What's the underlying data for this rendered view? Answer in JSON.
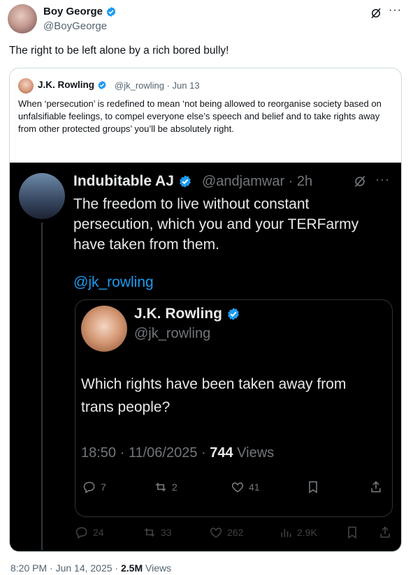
{
  "main_tweet": {
    "author_name": "Boy George",
    "author_handle": "@BoyGeorge",
    "text": "The right to be left alone by a rich bored bully!"
  },
  "quoted_tweet": {
    "author_name": "J.K. Rowling",
    "author_handle": "@jk_rowling · Jun 13",
    "text": "When ‘persecution’ is redefined to mean ‘not being allowed to reorganise society based on unfalsifiable feelings, to compel everyone else’s speech and belief and to take rights away from other protected groups’ you’ll be absolutely right."
  },
  "screenshot": {
    "reply": {
      "author_name": "Indubitable AJ",
      "author_handle": "@andjamwar · 2h",
      "text": "The freedom to live without constant persecution, which you and your TERFarmy have taken from them.",
      "mention": "@jk_rowling"
    },
    "inner_quote": {
      "author_name": "J.K. Rowling",
      "author_handle": "@jk_rowling",
      "text": "Which rights have been taken away from trans people?",
      "timestamp": "18:50 · 11/06/2025 · ",
      "views_count": "744",
      "views_label": " Views",
      "replies": "7",
      "reposts": "2",
      "likes": "41"
    },
    "reply_stats": {
      "replies": "24",
      "reposts": "33",
      "likes": "262",
      "views": "2.9K"
    }
  },
  "footer": {
    "timestamp": "8:20 PM · Jun 14, 2025 · ",
    "views_count": "2.5M",
    "views_label": " Views"
  },
  "colors": {
    "verified": "#1d9bf0",
    "link": "#1d9bf0",
    "dark_bg": "#000000"
  },
  "icons": [
    "verified-badge-icon",
    "grok-icon",
    "more-icon",
    "reply-icon",
    "repost-icon",
    "like-icon",
    "bookmark-icon",
    "share-icon",
    "views-icon"
  ]
}
